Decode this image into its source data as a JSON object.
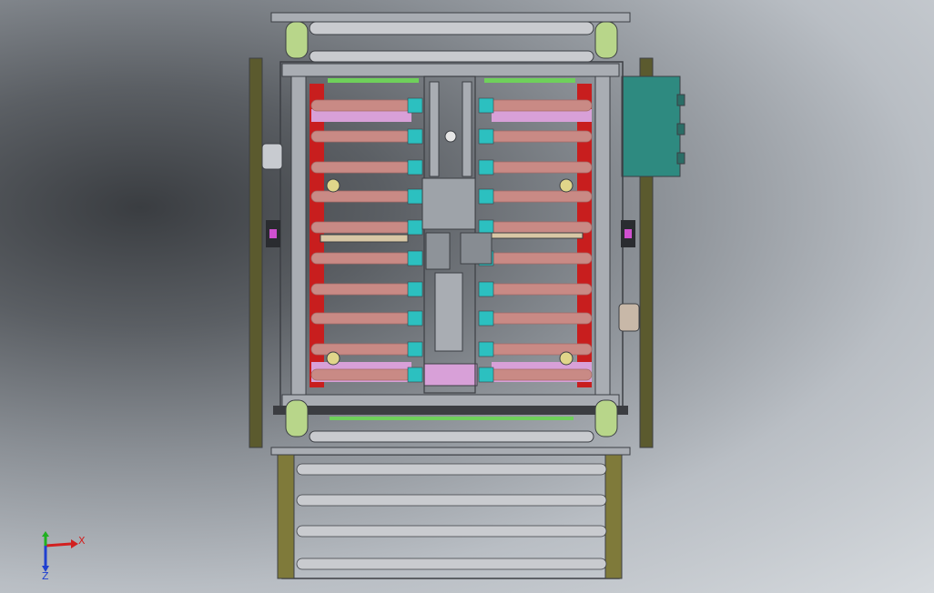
{
  "view": {
    "background_colors": [
      "#3a3d41",
      "#8a8f95",
      "#d6dade"
    ]
  },
  "model": {
    "colors": {
      "frame": "#a9adb3",
      "frame_stroke": "#3c3f44",
      "corner_pad": "#b8d68a",
      "roller": "#c98a85",
      "roller_dark": "#a56b67",
      "guide": "#2cc0c0",
      "red_rail": "#c81e1e",
      "magenta_plate": "#d8a0d8",
      "green_strip": "#6fd05b",
      "side_rail": "#5b5a2e",
      "control_box": "#2e8a80",
      "out_roller": "#c9cbcf",
      "cylinder": "#d8c7a5"
    }
  },
  "triad": {
    "x_label": "X",
    "z_label": "Z",
    "x_color": "#d22020",
    "y_color": "#20b020",
    "z_color": "#2040d0"
  }
}
